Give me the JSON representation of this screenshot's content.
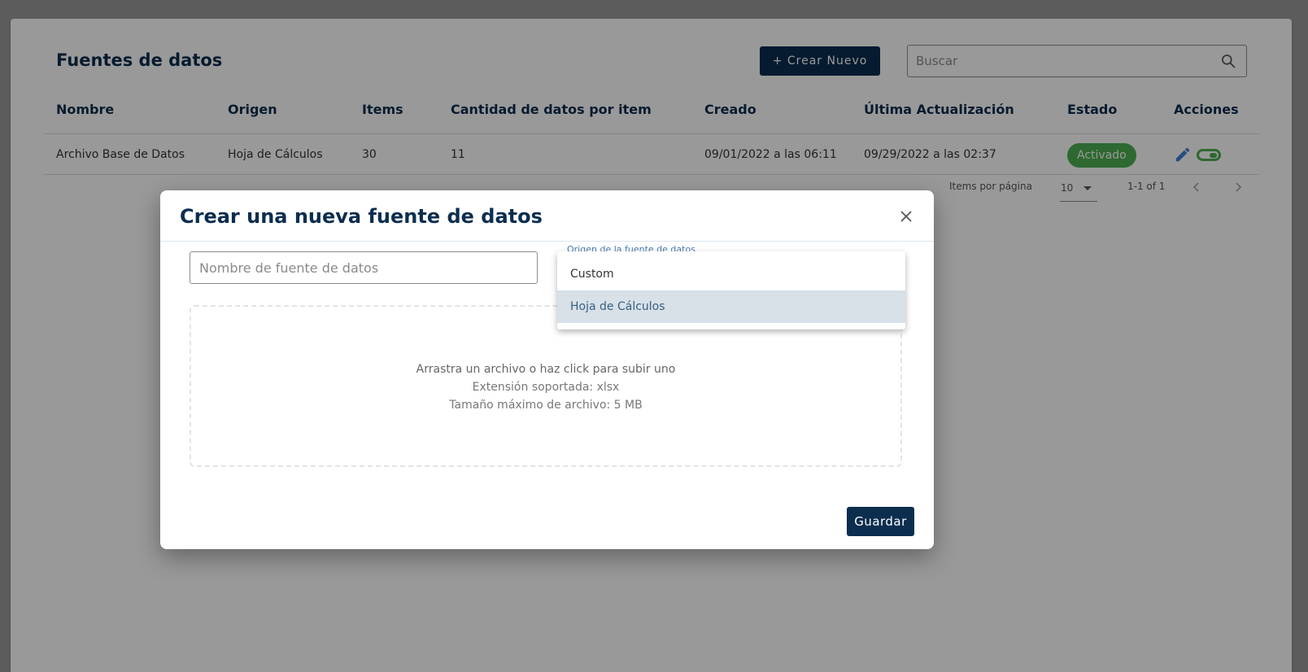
{
  "page": {
    "title": "Fuentes de datos",
    "create_label": "+ Crear Nuevo",
    "search_placeholder": "Buscar"
  },
  "table": {
    "headers": [
      "Nombre",
      "Origen",
      "Items",
      "Cantidad de datos por item",
      "Creado",
      "Última Actualización",
      "Estado",
      "Acciones"
    ],
    "rows": [
      {
        "nombre": "Archivo Base de Datos",
        "origen": "Hoja de Cálculos",
        "items": "30",
        "cantidad": "11",
        "creado": "09/01/2022 a las 06:11",
        "actualizacion": "09/29/2022 a las 02:37",
        "estado": "Activado"
      }
    ]
  },
  "pagination": {
    "per_page_label": "Items por página",
    "per_page_value": "10",
    "range": "1-1 of 1"
  },
  "modal": {
    "title": "Crear una nueva fuente de datos",
    "name_placeholder": "Nombre de fuente de datos",
    "select_label": "Origen de la fuente de datos",
    "dropzone": {
      "line1": "Arrastra un archivo o haz click para subir uno",
      "line2": "Extensión soportada: xlsx",
      "line3": "Tamaño máximo de archivo: 5 MB"
    },
    "save_label": "Guardar"
  },
  "dropdown": {
    "options": [
      "Custom",
      "Hoja de Cálculos"
    ],
    "selected": "Hoja de Cálculos"
  },
  "colors": {
    "primary": "#0b2e4f",
    "success": "#4caf50",
    "edit": "#3d7fd9"
  }
}
